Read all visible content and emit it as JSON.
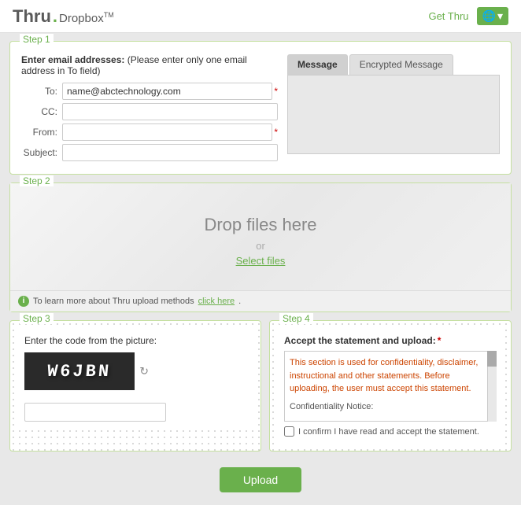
{
  "header": {
    "logo_thru": "Thru",
    "logo_dot": ".",
    "logo_dropbox": "Dropbox",
    "logo_tm": "TM",
    "get_thru_label": "Get Thru",
    "globe_icon": "🌐",
    "chevron_icon": "▾"
  },
  "step1": {
    "label": "Step 1",
    "instruction_bold": "Enter email addresses:",
    "instruction_rest": " (Please enter only one email address in To field)",
    "to_label": "To:",
    "to_value": "name@abctechnology.com",
    "cc_label": "CC:",
    "cc_value": "",
    "from_label": "From:",
    "from_value": "",
    "subject_label": "Subject:",
    "subject_value": "",
    "tabs": [
      {
        "id": "message",
        "label": "Message",
        "active": true
      },
      {
        "id": "encrypted",
        "label": "Encrypted Message",
        "active": false
      }
    ],
    "message_placeholder": ""
  },
  "step2": {
    "label": "Step 2",
    "drop_text": "Drop files here",
    "or_text": "or",
    "select_files_label": "Select files",
    "info_text": "To learn more about Thru upload methods ",
    "click_here_label": "click here",
    "info_suffix": "."
  },
  "step3": {
    "label": "Step 3",
    "captcha_label": "Enter the code from the picture:",
    "captcha_value": "W6JBN",
    "captcha_input_value": "",
    "refresh_icon": "↻"
  },
  "step4": {
    "label": "Step 4",
    "accept_label": "Accept the statement and upload:",
    "required_star": "*",
    "body_text": "This section is used for confidentiality, disclaimer, instructional and other statements. Before uploading, the user must accept this statement.",
    "section_title": "Confidentiality Notice:",
    "checkbox_label": "I confirm I have read and accept the statement.",
    "checkbox_checked": false
  },
  "upload": {
    "button_label": "Upload"
  }
}
